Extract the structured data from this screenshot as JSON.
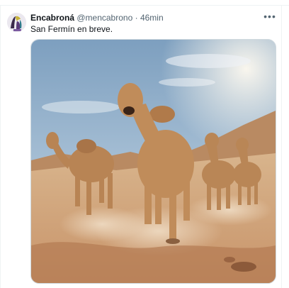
{
  "tweet": {
    "display_name": "Encabroná",
    "handle": "@mencabrono",
    "separator": "·",
    "time": "46min",
    "text": "San Fermín en breve.",
    "more_icon": "more-horizontal-icon",
    "media_description": "camels-running-desert-image"
  },
  "colors": {
    "text_primary": "#0f1419",
    "text_secondary": "#536471",
    "border": "#cfd9de"
  }
}
